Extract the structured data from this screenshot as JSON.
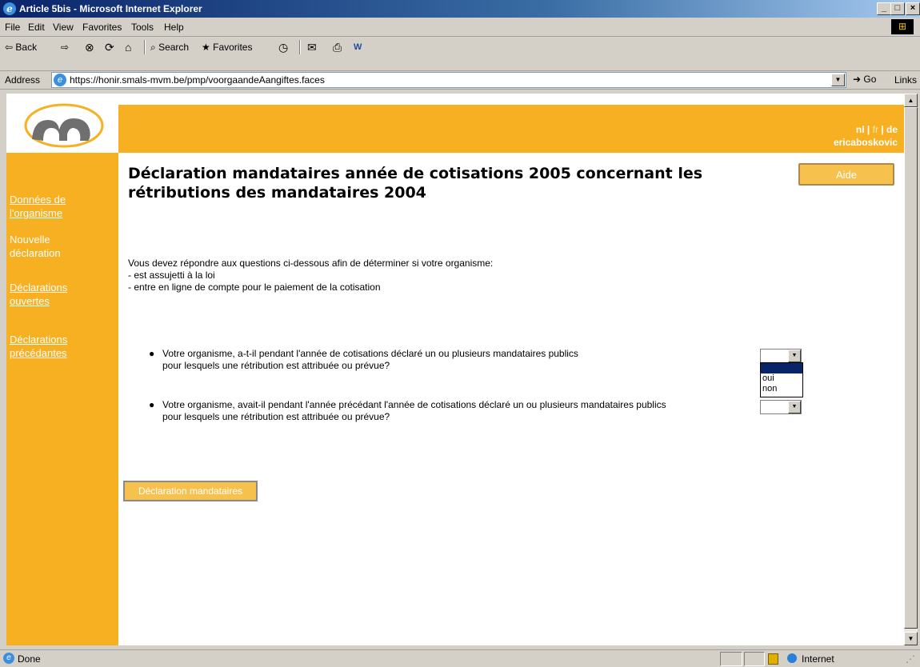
{
  "window": {
    "title": "Article 5bis - Microsoft Internet Explorer",
    "min": "_",
    "max": "□",
    "close": "×"
  },
  "menu": {
    "file": "File",
    "edit": "Edit",
    "view": "View",
    "favorites": "Favorites",
    "tools": "Tools",
    "help": "Help"
  },
  "toolbar": {
    "back": "⇦ Back",
    "forward": "⇨",
    "stop": "⊗",
    "refresh": "⟳",
    "home": "⌂",
    "search": "Search",
    "favorites": "Favorites",
    "history": "◷",
    "mail": "✉",
    "print": "⎙",
    "edit": "W"
  },
  "address": {
    "label": "Address",
    "url": "https://honir.smals-mvm.be/pmp/voorgaandeAangiftes.faces",
    "go": "Go",
    "links": "Links"
  },
  "header": {
    "lang_nl": "nl",
    "lang_fr": "fr",
    "lang_de": "de",
    "lang_sep": " | ",
    "username": "ericaboskovic"
  },
  "nav": {
    "donnees_line1": "Données de",
    "donnees_line2": "l'organisme",
    "nouvelle_line1": "Nouvelle",
    "nouvelle_line2": "déclaration",
    "ouvertes_line1": "Déclarations",
    "ouvertes_line2": "ouvertes",
    "precedantes_line1": "Déclarations",
    "precedantes_line2": "précédantes"
  },
  "main": {
    "title_line1": "Déclaration mandataires année de cotisations 2005 concernant les",
    "title_line2": "rétributions des mandataires 2004",
    "help_button": "Aide",
    "intro_line1": "Vous devez répondre aux questions ci-dessous afin de déterminer si votre organisme:",
    "intro_line2": "- est assujetti à la loi",
    "intro_line3": "- entre en ligne de compte pour le paiement de la cotisation",
    "q1_line1": "Votre organisme, a-t-il pendant l'année de cotisations déclaré un ou plusieurs mandataires publics",
    "q1_line2": "pour lesquels une rétribution est attribuée ou prévue?",
    "q2_line1": "Votre organisme, avait-il pendant l'année précédant l'année de cotisations déclaré un ou plusieurs mandataires publics",
    "q2_line2": "pour lesquels une rétribution est attribuée ou prévue?",
    "options": [
      "",
      "oui",
      "non"
    ],
    "submit_button": "Déclaration mandataires"
  },
  "status": {
    "text": "Done",
    "zone": "Internet"
  },
  "colors": {
    "brand_orange": "#f7b021",
    "title_bar": "#0a246a"
  }
}
